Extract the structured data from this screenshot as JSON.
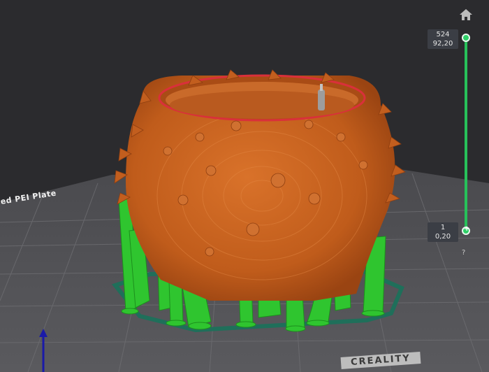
{
  "layer_slider": {
    "top_label": {
      "layer": "524",
      "height": "92,20"
    },
    "bottom_label": {
      "layer": "1",
      "height": "0,20"
    },
    "help": "?"
  },
  "build_plate": {
    "plate_name": "red PEI Plate",
    "brand": "CREALITY"
  },
  "colors": {
    "background": "#2b2b2e",
    "model": "#c9651f",
    "support": "#2fc52f",
    "slider": "#27c15a",
    "brim": "#1f6f5a",
    "axis": "#1a1aa8"
  },
  "icons": {
    "home": "home-icon"
  }
}
